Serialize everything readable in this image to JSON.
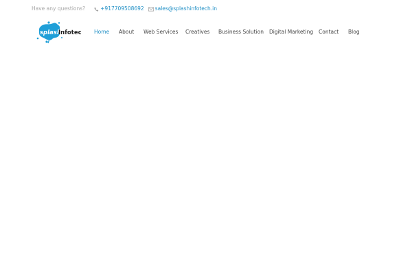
{
  "topbar": {
    "question": "Have any questions?",
    "phone": "+917709508692",
    "email": "sales@splashinfotech.in",
    "phone_icon": "phone-icon",
    "email_icon": "envelope-icon"
  },
  "logo": {
    "text_splash": "splash",
    "text_infotech": "Infotech",
    "splash_color": "#1f9fd8"
  },
  "nav": {
    "items": [
      {
        "label": "Home",
        "active": true
      },
      {
        "label": "About"
      },
      {
        "label": "Web Services"
      },
      {
        "label": "Creatives"
      },
      {
        "label": "Business Solution"
      },
      {
        "label": "Digital Marketing"
      },
      {
        "label": "Contact"
      },
      {
        "label": "Blog"
      }
    ]
  },
  "colors": {
    "accent": "#1f8fc5",
    "nav_text": "#444444",
    "muted": "#a5a5a5"
  }
}
